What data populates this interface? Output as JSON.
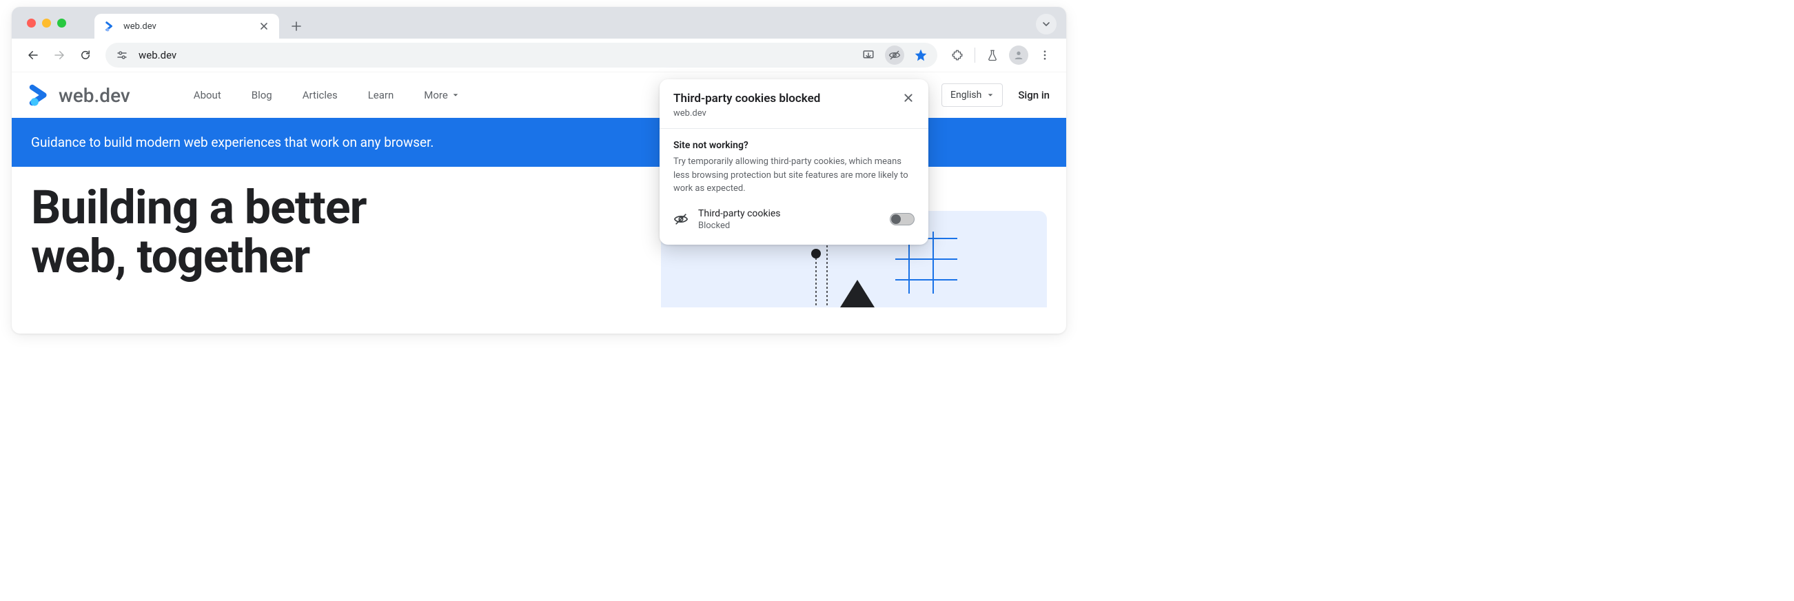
{
  "window": {
    "tab_title": "web.dev",
    "url": "web.dev"
  },
  "site": {
    "logo_text": "web.dev",
    "nav": [
      "About",
      "Blog",
      "Articles",
      "Learn",
      "More"
    ],
    "language": "English",
    "signin": "Sign in",
    "banner": "Guidance to build modern web experiences that work on any browser.",
    "hero_line1": "Building a better",
    "hero_line2": "web, together"
  },
  "popover": {
    "title": "Third-party cookies blocked",
    "subtitle": "web.dev",
    "body_heading": "Site not working?",
    "body_text": "Try temporarily allowing third-party cookies, which means less browsing protection but site features are more likely to work as expected.",
    "toggle_label": "Third-party cookies",
    "toggle_status": "Blocked"
  }
}
